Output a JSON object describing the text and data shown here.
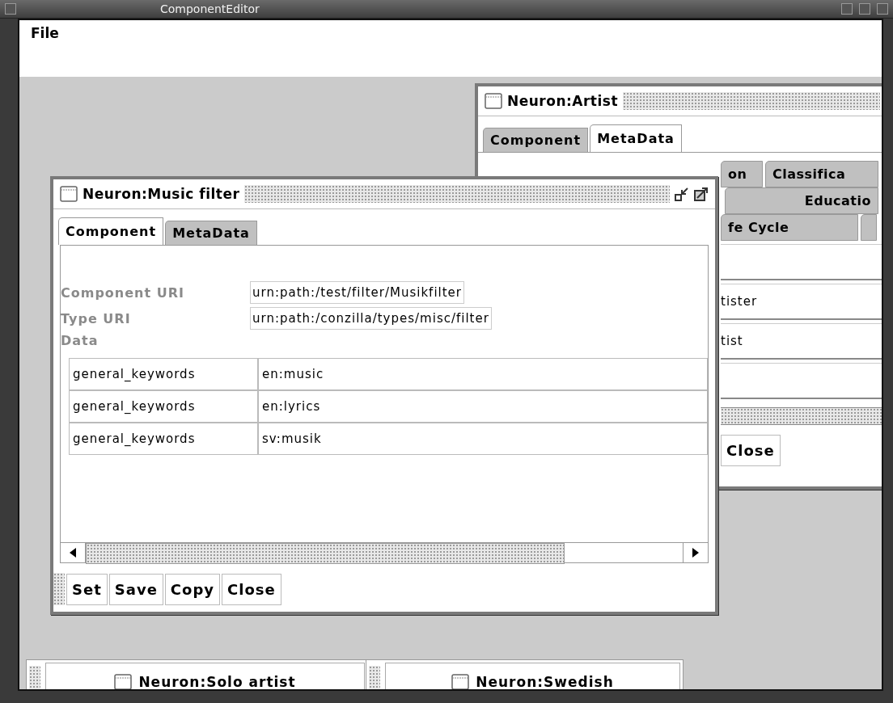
{
  "window": {
    "title": "ComponentEditor"
  },
  "menu": [
    "File"
  ],
  "artist_window": {
    "title": "Neuron:Artist",
    "tabs": [
      {
        "label": "Component",
        "selected": false
      },
      {
        "label": "MetaData",
        "selected": true
      }
    ],
    "tab_rows": [
      [
        {
          "kind": "label",
          "label": "on"
        },
        {
          "kind": "label",
          "label": "Classifica"
        }
      ],
      [
        {
          "kind": "label",
          "label": "Educatio"
        }
      ],
      [
        {
          "kind": "label",
          "label": "fe Cycle"
        },
        {
          "kind": "blank"
        }
      ]
    ],
    "fields": [
      {
        "kind": "empty"
      },
      {
        "kind": "text",
        "value": "tister"
      },
      {
        "kind": "text",
        "value": "tist"
      },
      {
        "kind": "empty"
      }
    ],
    "buttons": [
      "Close"
    ]
  },
  "filter_window": {
    "title": "Neuron:Music filter",
    "tabs": [
      {
        "label": "Component",
        "selected": true
      },
      {
        "label": "MetaData",
        "selected": false
      }
    ],
    "fields": [
      {
        "label": "Component URI",
        "value": "urn:path:/test/filter/Musikfilter"
      },
      {
        "label": "Type URI",
        "value": "urn:path:/conzilla/types/misc/filter"
      }
    ],
    "data_label": "Data",
    "data_rows": [
      {
        "key": "general_keywords",
        "value": "en:music"
      },
      {
        "key": "general_keywords",
        "value": "en:lyrics"
      },
      {
        "key": "general_keywords",
        "value": "sv:musik"
      }
    ],
    "buttons": [
      "Set",
      "Save",
      "Copy",
      "Close"
    ]
  },
  "minimized_windows": [
    {
      "title": "Neuron:Solo artist"
    },
    {
      "title": "Neuron:Swedish"
    }
  ]
}
